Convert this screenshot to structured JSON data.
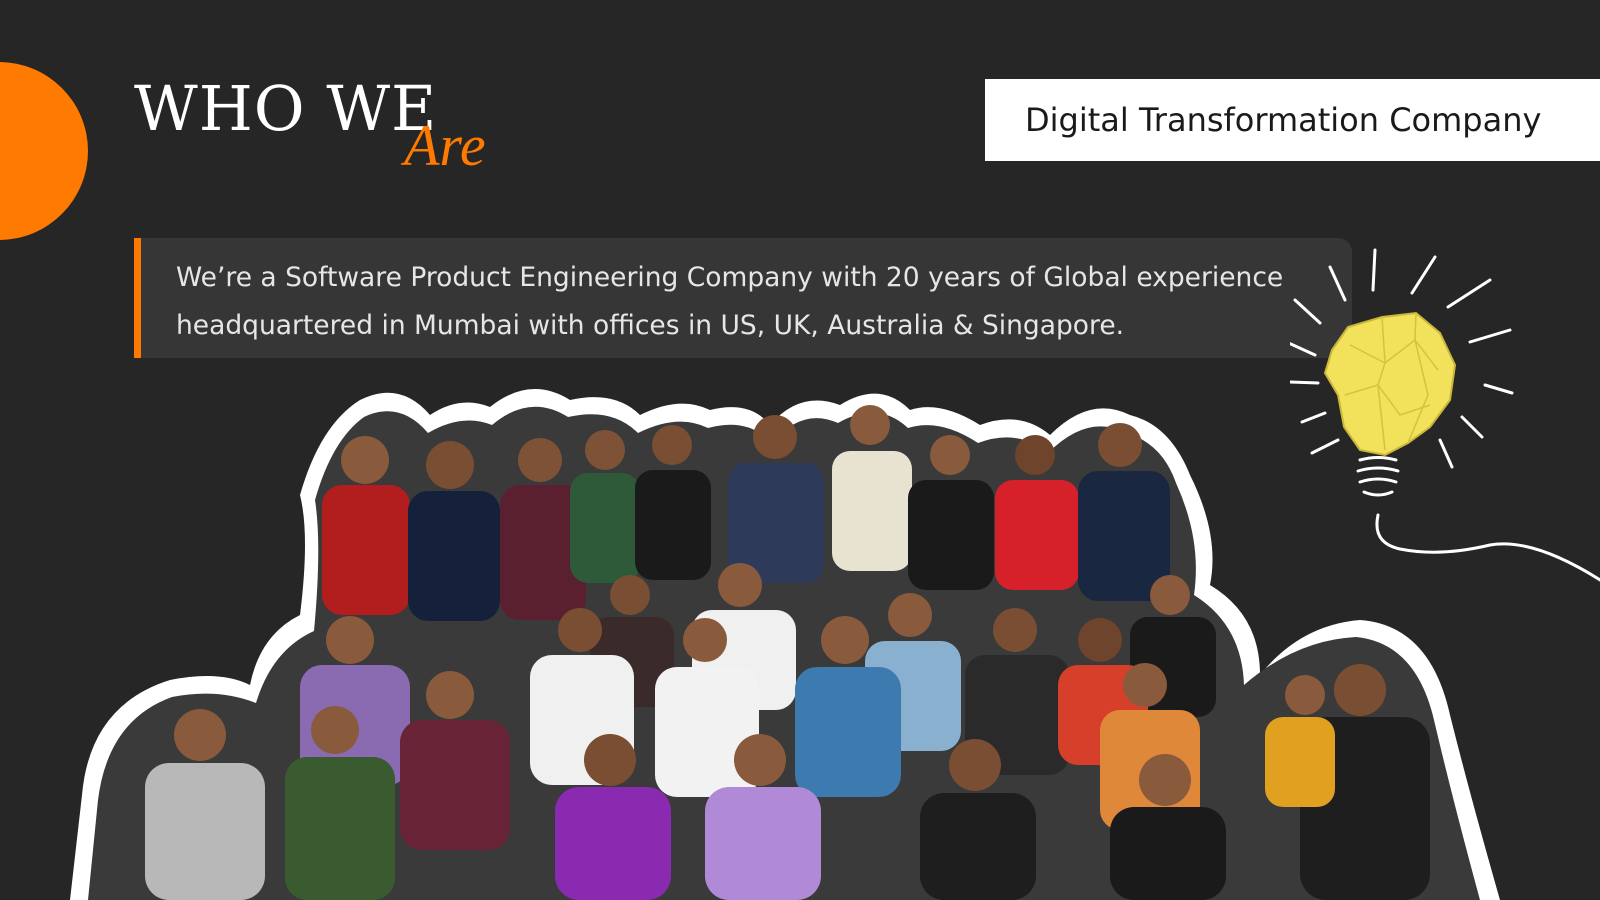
{
  "header": {
    "title_main": "WHO WE",
    "title_script": "Are"
  },
  "tagline": {
    "label": "Digital Transformation Company"
  },
  "intro": {
    "line1": "We’re a  Software Product Engineering Company with 20 years of Global experience",
    "line2": "headquartered in Mumbai with offices in US, UK, Australia & Singapore."
  },
  "colors": {
    "background": "#262626",
    "accent": "#ff7a00",
    "panel": "#363636",
    "tag_background": "#ffffff"
  },
  "icons": {
    "bulb": "crumpled-paper-lightbulb-icon"
  },
  "images": {
    "team": "team-group-photo"
  }
}
